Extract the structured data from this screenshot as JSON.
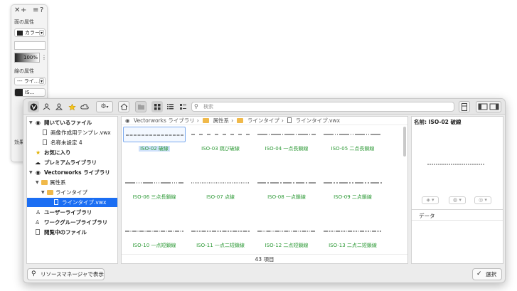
{
  "attributes": {
    "toolbar": {
      "close": "✕",
      "add": "+",
      "menu": "≡",
      "help": "?"
    },
    "fill_label": "面の属性",
    "fill_select": "カラー",
    "opacity": "100%",
    "line_label": "線の属性",
    "line_select": "--- ライ…",
    "line_color": "IS…",
    "effect_label": "効果"
  },
  "toolbar": {
    "search_placeholder": "検索"
  },
  "sidebar": {
    "items": [
      {
        "label": "開いているファイル"
      },
      {
        "label": "画像作成用テンプレ.vwx"
      },
      {
        "label": "名称未設定 4"
      },
      {
        "label": "お気に入り"
      },
      {
        "label": "プレミアムライブラリ"
      },
      {
        "label": "Vectorworks ライブラリ"
      },
      {
        "label": "属性系"
      },
      {
        "label": "ラインタイプ"
      },
      {
        "label": "ラインタイプ.vwx"
      },
      {
        "label": "ユーザーライブラリ"
      },
      {
        "label": "ワークグループライブラリ"
      },
      {
        "label": "閲覧中のファイル"
      }
    ]
  },
  "breadcrumb": [
    "Vectorworks ライブラリ",
    "属性系",
    "ラインタイプ",
    "ラインタイプ.vwx"
  ],
  "resources": [
    {
      "name": "ISO-02 破線"
    },
    {
      "name": "ISO-03 跳び破線"
    },
    {
      "name": "ISO-04 一点長鎖線"
    },
    {
      "name": "ISO-05 二点長鎖線"
    },
    {
      "name": "ISO-06 三点長鎖線"
    },
    {
      "name": "ISO-07 点線"
    },
    {
      "name": "ISO-08 一点鎖線"
    },
    {
      "name": "ISO-09 二点鎖線"
    },
    {
      "name": "ISO-10 一点短鎖線"
    },
    {
      "name": "ISO-11 一点二短鎖線"
    },
    {
      "name": "ISO-12 二点短鎖線"
    },
    {
      "name": "ISO-13 二点二短鎖線"
    }
  ],
  "status": {
    "count": "43 項目"
  },
  "details": {
    "name_label": "名前:",
    "name_value": "ISO-02 破線",
    "data_header": "データ"
  },
  "footer": {
    "show_in_rm": "リソースマネージャで表示",
    "select": "選択"
  }
}
